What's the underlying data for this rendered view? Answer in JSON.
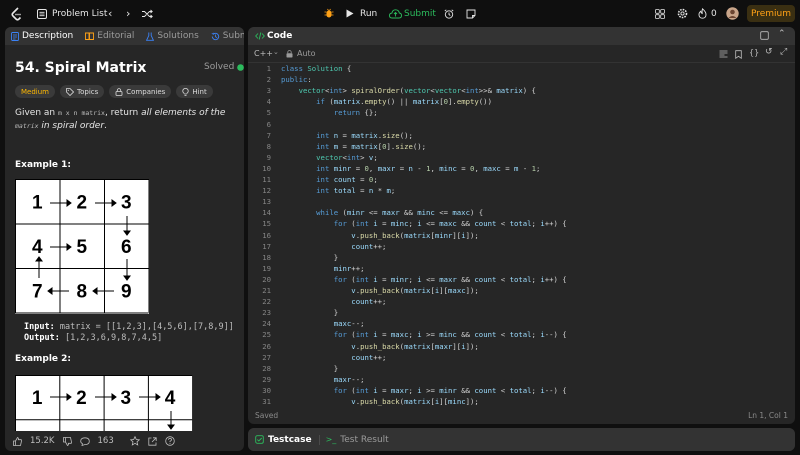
{
  "topbar": {
    "problem_list": "Problem List",
    "run": "Run",
    "submit": "Submit",
    "streak": "0",
    "premium": "Premium"
  },
  "left": {
    "tabs": [
      "Description",
      "Editorial",
      "Solutions",
      "Submissions"
    ],
    "title": "54. Spiral Matrix",
    "solved": "Solved",
    "tags": [
      "Medium",
      "Topics",
      "Companies",
      "Hint"
    ],
    "desc_a": "Given an ",
    "desc_code1": "m x n matrix",
    "desc_b": ", return ",
    "desc_c": "all elements of the ",
    "desc_code2": "matrix",
    "desc_d": " in spiral order",
    "desc_e": ".",
    "example1": "Example 1:",
    "example2": "Example 2:",
    "input_label": "Input:",
    "input_value": "matrix = [[1,2,3],[4,5,6],[7,8,9]]",
    "output_label": "Output:",
    "output_value": "[1,2,3,6,9,8,7,4,5]",
    "grid1": [
      "1",
      "2",
      "3",
      "4",
      "5",
      "6",
      "7",
      "8",
      "9"
    ],
    "grid2": [
      "1",
      "2",
      "3",
      "4"
    ],
    "likes": "15.2K",
    "comments": "163"
  },
  "code": {
    "title": "Code",
    "language": "C++",
    "mode": "Auto",
    "status": "Saved",
    "cursor": "Ln 1, Col 1",
    "lines": [
      "class Solution {",
      "public:",
      "    vector<int> spiralOrder(vector<vector<int>>& matrix) {",
      "        if (matrix.empty() || matrix[0].empty())",
      "            return {};",
      "",
      "        int n = matrix.size();",
      "        int m = matrix[0].size();",
      "        vector<int> v;",
      "        int minr = 0, maxr = n - 1, minc = 0, maxc = m - 1;",
      "        int count = 0;",
      "        int total = n * m;",
      "",
      "        while (minr <= maxr && minc <= maxc) {",
      "            for (int i = minc; i <= maxc && count < total; i++) {",
      "                v.push_back(matrix[minr][i]);",
      "                count++;",
      "            }",
      "            minr++;",
      "            for (int i = minr; i <= maxr && count < total; i++) {",
      "                v.push_back(matrix[i][maxc]);",
      "                count++;",
      "            }",
      "            maxc--;",
      "            for (int i = maxc; i >= minc && count < total; i--) {",
      "                v.push_back(matrix[maxr][i]);",
      "                count++;",
      "            }",
      "            maxr--;",
      "            for (int i = maxr; i >= minr && count < total; i--) {",
      "                v.push_back(matrix[i][minc]);"
    ]
  },
  "bottom": {
    "testcase": "Testcase",
    "result": "Test Result"
  },
  "colors": {
    "accent": "#ffa116",
    "run_green": "#2cbb5d",
    "keyword": "#569cd6",
    "type": "#4ec9b0",
    "number": "#b5cea8",
    "func": "#dcdcaa"
  }
}
